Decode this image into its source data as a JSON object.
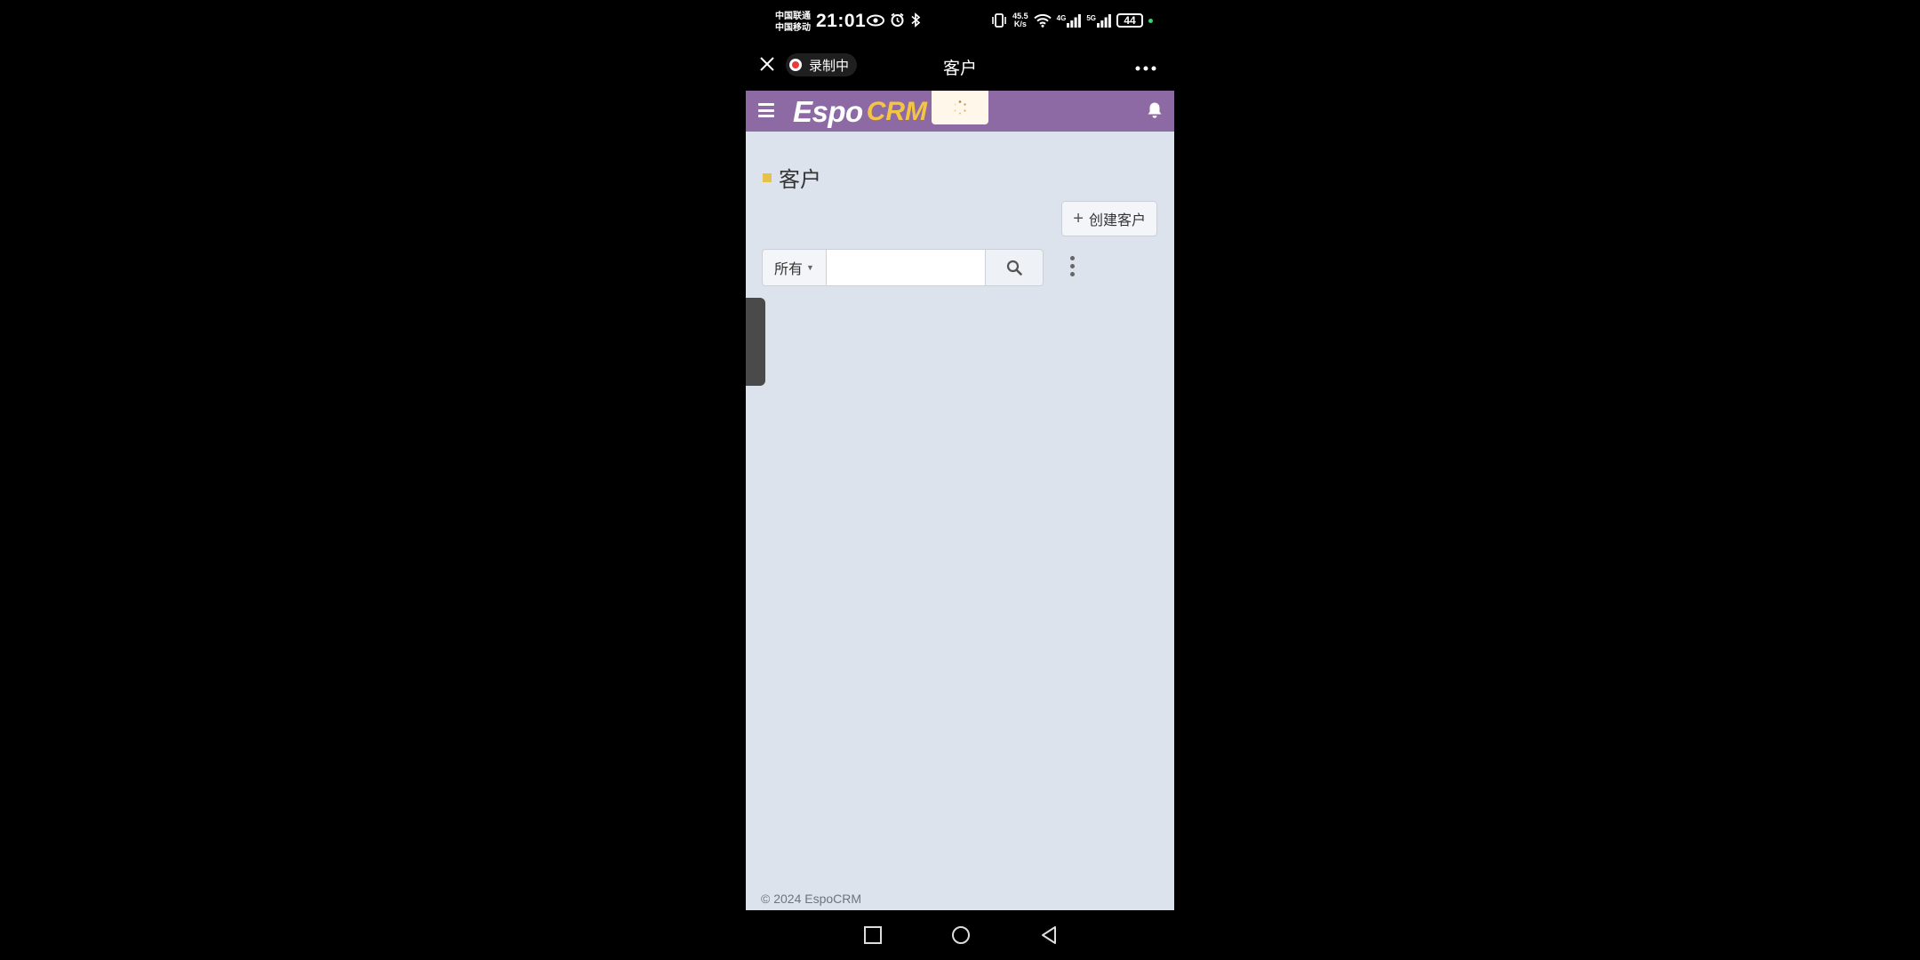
{
  "status_bar": {
    "carrier_1": "中国联通",
    "carrier_2": "中国移动",
    "time": "21:01",
    "net_speed_value": "45.5",
    "net_speed_unit": "K/s",
    "net_4g": "4G",
    "net_5g": "5G",
    "battery": "44"
  },
  "topbar": {
    "recording_label": "录制中",
    "title": "客户"
  },
  "app": {
    "brand": "Espo",
    "brand_suffix": "CRM",
    "page_title": "客户",
    "create_button_label": "创建客户",
    "filter_label": "所有",
    "search_placeholder": "",
    "search_value": "",
    "footer": "© 2024 EspoCRM",
    "colors": {
      "navbar": "#8d6aa3",
      "background": "#dde3ec",
      "title_marker": "#e8c14a"
    }
  },
  "icons": {
    "close": "close-icon",
    "more": "more-horizontal-icon",
    "menu": "hamburger-menu-icon",
    "bell": "bell-icon",
    "search": "search-icon",
    "kebab": "more-vertical-icon",
    "loading": "spinner-icon"
  }
}
